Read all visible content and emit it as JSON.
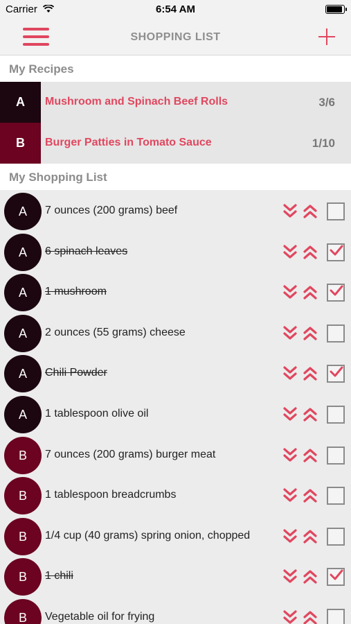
{
  "status": {
    "carrier": "Carrier",
    "time": "6:54 AM",
    "battery_level": 1.0
  },
  "nav": {
    "title": "SHOPPING LIST",
    "menu_icon": "hamburger-icon",
    "add_icon": "plus-icon"
  },
  "recipes_section": {
    "title": "My Recipes"
  },
  "recipes": [
    {
      "letter": "A",
      "name": "Mushroom and Spinach Beef Rolls",
      "count": "3/6",
      "color": "#1c0610"
    },
    {
      "letter": "B",
      "name": "Burger Patties in Tomato Sauce",
      "count": "1/10",
      "color": "#6b0321"
    }
  ],
  "shopping_section": {
    "title": "My Shopping List"
  },
  "items": [
    {
      "letter": "A",
      "text": "7 ounces (200 grams) beef",
      "checked": false
    },
    {
      "letter": "A",
      "text": "6 spinach leaves",
      "checked": true
    },
    {
      "letter": "A",
      "text": "1 mushroom",
      "checked": true
    },
    {
      "letter": "A",
      "text": "2 ounces (55 grams) cheese",
      "checked": false
    },
    {
      "letter": "A",
      "text": "Chili Powder",
      "checked": true
    },
    {
      "letter": "A",
      "text": "1 tablespoon olive oil",
      "checked": false
    },
    {
      "letter": "B",
      "text": "7 ounces (200 grams) burger meat",
      "checked": false
    },
    {
      "letter": "B",
      "text": "1 tablespoon breadcrumbs",
      "checked": false
    },
    {
      "letter": "B",
      "text": "1/4 cup (40 grams) spring onion, chopped",
      "checked": false
    },
    {
      "letter": "B",
      "text": "1 chili",
      "checked": true
    },
    {
      "letter": "B",
      "text": "Vegetable oil for frying",
      "checked": false
    }
  ],
  "colors": {
    "accent": "#e0475f",
    "recipe_a": "#1c0610",
    "recipe_b": "#6b0321"
  },
  "icons": {
    "move_down": "double-chevron-down-icon",
    "move_up": "double-chevron-up-icon",
    "checkbox": "checkbox-icon"
  }
}
